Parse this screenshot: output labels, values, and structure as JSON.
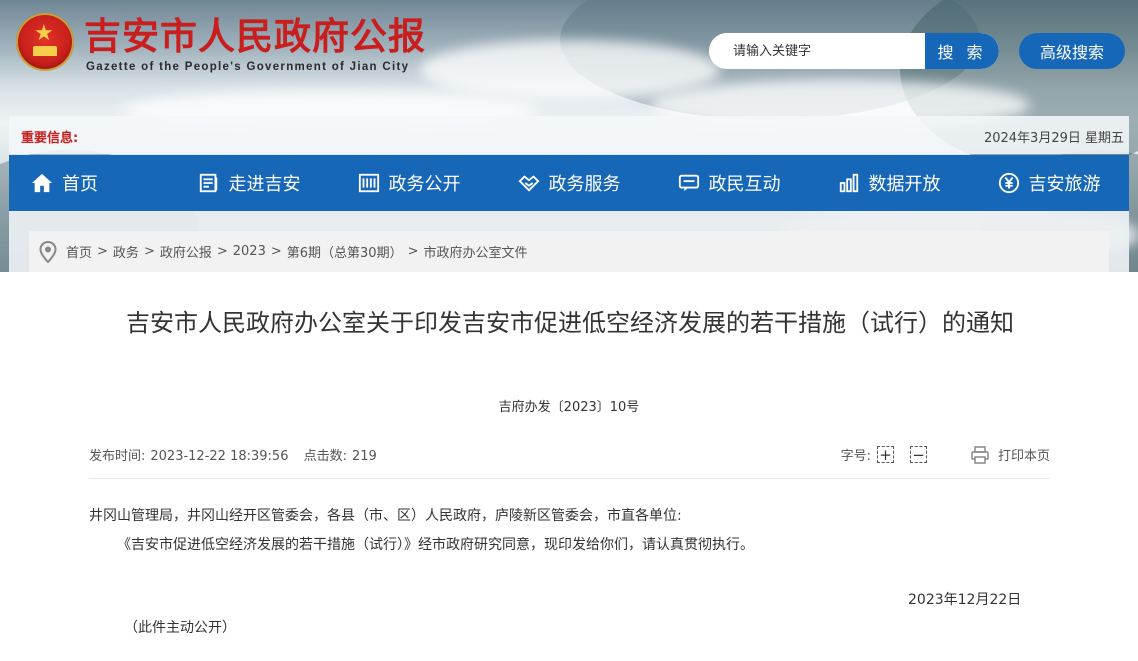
{
  "header": {
    "site_title": "吉安市人民政府公报",
    "site_subtitle": "Gazette of the People's Government of Jian City",
    "search_placeholder": "请输入关键字",
    "search_button": "搜 索",
    "advanced_search_button": "高级搜索"
  },
  "notice": {
    "label": "重要信息:",
    "date": "2024年3月29日 星期五"
  },
  "nav": {
    "items": [
      {
        "label": "首页",
        "icon": "home-icon"
      },
      {
        "label": "走进吉安",
        "icon": "document-icon"
      },
      {
        "label": "政务公开",
        "icon": "building-icon"
      },
      {
        "label": "政务服务",
        "icon": "handshake-icon"
      },
      {
        "label": "政民互动",
        "icon": "chat-icon"
      },
      {
        "label": "数据开放",
        "icon": "bar-chart-icon"
      },
      {
        "label": "吉安旅游",
        "icon": "yen-shield-icon"
      }
    ]
  },
  "breadcrumb": {
    "items": [
      "首页",
      "政务",
      "政府公报",
      "2023",
      "第6期（总第30期）",
      "市政府办公室文件"
    ],
    "separator": ">"
  },
  "article": {
    "title": "吉安市人民政府办公室关于印发吉安市促进低空经济发展的若干措施（试行）的通知",
    "doc_number": "吉府办发〔2023〕10号",
    "publish_time_label": "发布时间:",
    "publish_time": "2023-12-22 18:39:56",
    "clicks_label": "点击数:",
    "clicks": "219",
    "font_size_label": "字号:",
    "font_increase": "+",
    "font_decrease": "−",
    "print_label": "打印本页",
    "recipients": "井冈山管理局，井冈山经开区管委会，各县（市、区）人民政府，庐陵新区管委会，市直各单位:",
    "paragraph": "《吉安市促进低空经济发展的若干措施（试行）》经市政府研究同意，现印发给你们，请认真贯彻执行。",
    "sign_date": "2023年12月22日",
    "disclosure": "（此件主动公开）"
  },
  "colors": {
    "brand_blue": "#1767b8",
    "title_red": "#c81e1e"
  }
}
